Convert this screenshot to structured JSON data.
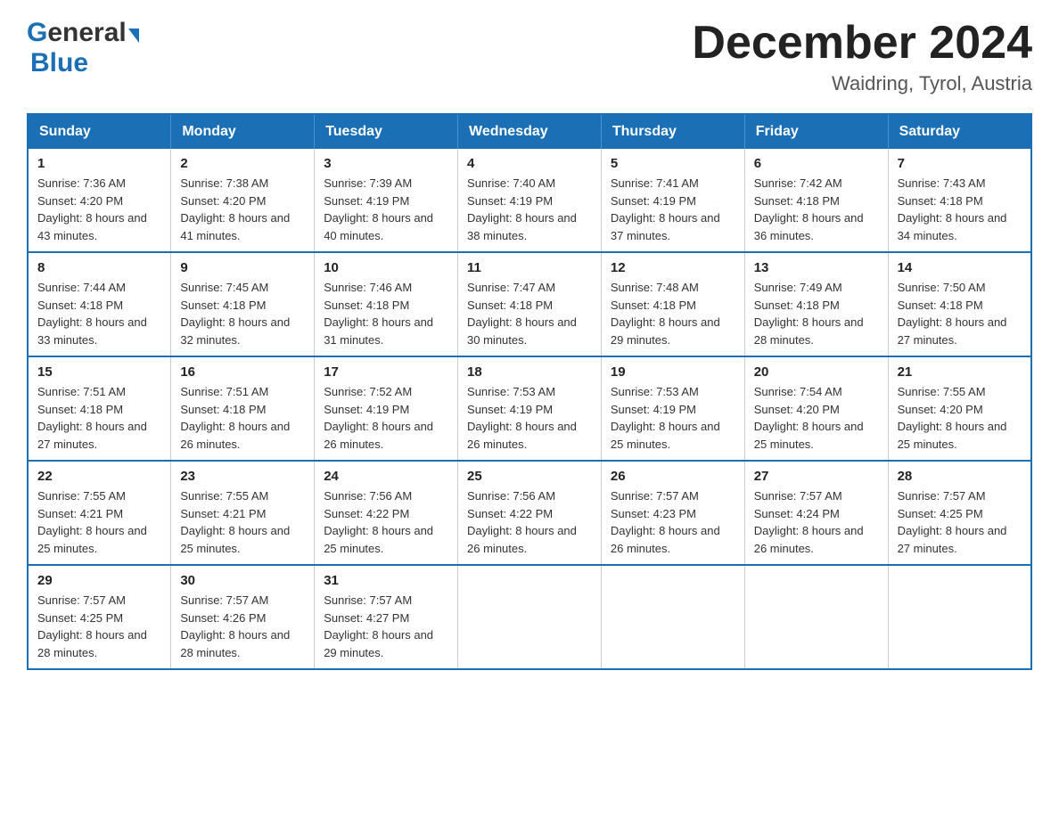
{
  "logo": {
    "general": "General",
    "blue": "Blue",
    "arrow": "▶"
  },
  "header": {
    "month": "December 2024",
    "location": "Waidring, Tyrol, Austria"
  },
  "weekdays": [
    "Sunday",
    "Monday",
    "Tuesday",
    "Wednesday",
    "Thursday",
    "Friday",
    "Saturday"
  ],
  "weeks": [
    [
      {
        "day": "1",
        "sunrise": "7:36 AM",
        "sunset": "4:20 PM",
        "daylight": "8 hours and 43 minutes."
      },
      {
        "day": "2",
        "sunrise": "7:38 AM",
        "sunset": "4:20 PM",
        "daylight": "8 hours and 41 minutes."
      },
      {
        "day": "3",
        "sunrise": "7:39 AM",
        "sunset": "4:19 PM",
        "daylight": "8 hours and 40 minutes."
      },
      {
        "day": "4",
        "sunrise": "7:40 AM",
        "sunset": "4:19 PM",
        "daylight": "8 hours and 38 minutes."
      },
      {
        "day": "5",
        "sunrise": "7:41 AM",
        "sunset": "4:19 PM",
        "daylight": "8 hours and 37 minutes."
      },
      {
        "day": "6",
        "sunrise": "7:42 AM",
        "sunset": "4:18 PM",
        "daylight": "8 hours and 36 minutes."
      },
      {
        "day": "7",
        "sunrise": "7:43 AM",
        "sunset": "4:18 PM",
        "daylight": "8 hours and 34 minutes."
      }
    ],
    [
      {
        "day": "8",
        "sunrise": "7:44 AM",
        "sunset": "4:18 PM",
        "daylight": "8 hours and 33 minutes."
      },
      {
        "day": "9",
        "sunrise": "7:45 AM",
        "sunset": "4:18 PM",
        "daylight": "8 hours and 32 minutes."
      },
      {
        "day": "10",
        "sunrise": "7:46 AM",
        "sunset": "4:18 PM",
        "daylight": "8 hours and 31 minutes."
      },
      {
        "day": "11",
        "sunrise": "7:47 AM",
        "sunset": "4:18 PM",
        "daylight": "8 hours and 30 minutes."
      },
      {
        "day": "12",
        "sunrise": "7:48 AM",
        "sunset": "4:18 PM",
        "daylight": "8 hours and 29 minutes."
      },
      {
        "day": "13",
        "sunrise": "7:49 AM",
        "sunset": "4:18 PM",
        "daylight": "8 hours and 28 minutes."
      },
      {
        "day": "14",
        "sunrise": "7:50 AM",
        "sunset": "4:18 PM",
        "daylight": "8 hours and 27 minutes."
      }
    ],
    [
      {
        "day": "15",
        "sunrise": "7:51 AM",
        "sunset": "4:18 PM",
        "daylight": "8 hours and 27 minutes."
      },
      {
        "day": "16",
        "sunrise": "7:51 AM",
        "sunset": "4:18 PM",
        "daylight": "8 hours and 26 minutes."
      },
      {
        "day": "17",
        "sunrise": "7:52 AM",
        "sunset": "4:19 PM",
        "daylight": "8 hours and 26 minutes."
      },
      {
        "day": "18",
        "sunrise": "7:53 AM",
        "sunset": "4:19 PM",
        "daylight": "8 hours and 26 minutes."
      },
      {
        "day": "19",
        "sunrise": "7:53 AM",
        "sunset": "4:19 PM",
        "daylight": "8 hours and 25 minutes."
      },
      {
        "day": "20",
        "sunrise": "7:54 AM",
        "sunset": "4:20 PM",
        "daylight": "8 hours and 25 minutes."
      },
      {
        "day": "21",
        "sunrise": "7:55 AM",
        "sunset": "4:20 PM",
        "daylight": "8 hours and 25 minutes."
      }
    ],
    [
      {
        "day": "22",
        "sunrise": "7:55 AM",
        "sunset": "4:21 PM",
        "daylight": "8 hours and 25 minutes."
      },
      {
        "day": "23",
        "sunrise": "7:55 AM",
        "sunset": "4:21 PM",
        "daylight": "8 hours and 25 minutes."
      },
      {
        "day": "24",
        "sunrise": "7:56 AM",
        "sunset": "4:22 PM",
        "daylight": "8 hours and 25 minutes."
      },
      {
        "day": "25",
        "sunrise": "7:56 AM",
        "sunset": "4:22 PM",
        "daylight": "8 hours and 26 minutes."
      },
      {
        "day": "26",
        "sunrise": "7:57 AM",
        "sunset": "4:23 PM",
        "daylight": "8 hours and 26 minutes."
      },
      {
        "day": "27",
        "sunrise": "7:57 AM",
        "sunset": "4:24 PM",
        "daylight": "8 hours and 26 minutes."
      },
      {
        "day": "28",
        "sunrise": "7:57 AM",
        "sunset": "4:25 PM",
        "daylight": "8 hours and 27 minutes."
      }
    ],
    [
      {
        "day": "29",
        "sunrise": "7:57 AM",
        "sunset": "4:25 PM",
        "daylight": "8 hours and 28 minutes."
      },
      {
        "day": "30",
        "sunrise": "7:57 AM",
        "sunset": "4:26 PM",
        "daylight": "8 hours and 28 minutes."
      },
      {
        "day": "31",
        "sunrise": "7:57 AM",
        "sunset": "4:27 PM",
        "daylight": "8 hours and 29 minutes."
      },
      null,
      null,
      null,
      null
    ]
  ],
  "labels": {
    "sunrise": "Sunrise:",
    "sunset": "Sunset:",
    "daylight": "Daylight:"
  }
}
